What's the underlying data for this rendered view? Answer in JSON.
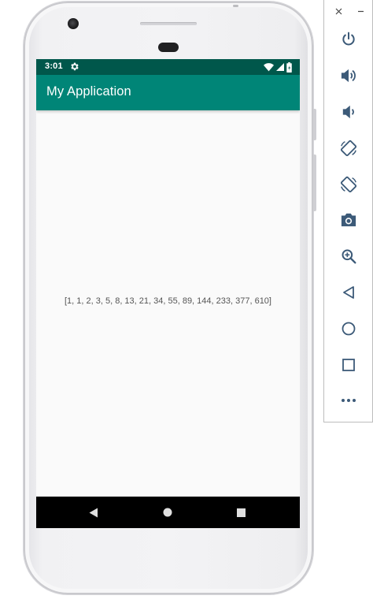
{
  "status_bar": {
    "time": "3:01",
    "background": "#00574b"
  },
  "app_bar": {
    "title": "My Application",
    "background": "#008577"
  },
  "content": {
    "text": "[1, 1, 2, 3, 5, 8, 13, 21, 34, 55, 89, 144, 233, 377, 610]"
  },
  "nav_bar": {
    "buttons": [
      "back-icon",
      "home-icon",
      "recents-icon"
    ]
  },
  "toolbar": {
    "window_controls": [
      "close-icon",
      "minimize-icon"
    ],
    "buttons": [
      "power-icon",
      "volume-up-icon",
      "volume-down-icon",
      "rotate-left-icon",
      "rotate-right-icon",
      "camera-icon",
      "zoom-icon",
      "back-icon",
      "home-icon",
      "overview-icon",
      "more-icon"
    ],
    "icon_color": "#3c5a78"
  }
}
